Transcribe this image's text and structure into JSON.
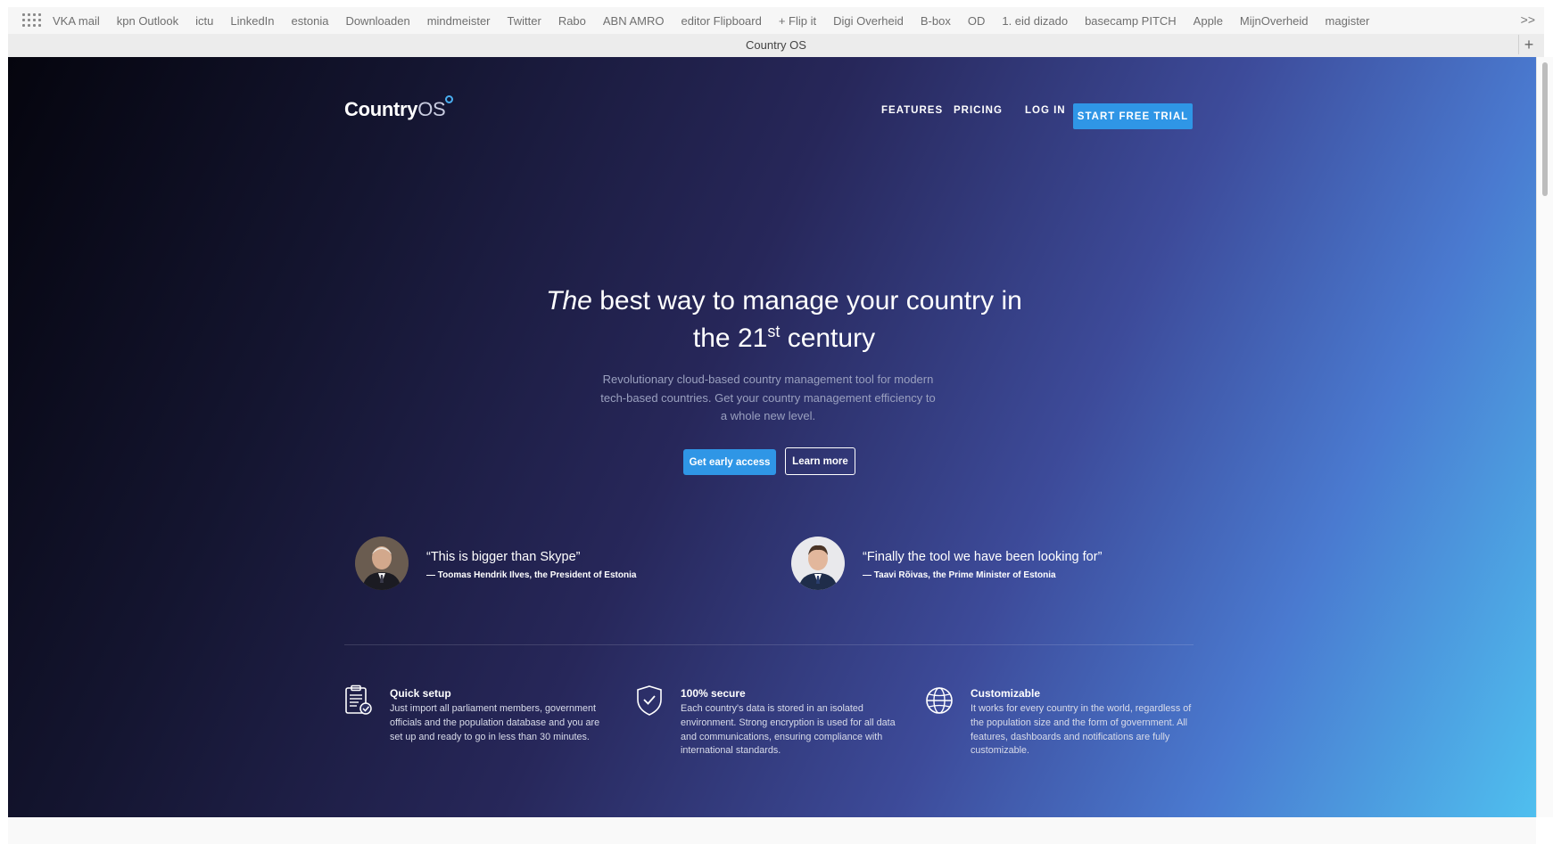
{
  "bookmarks": [
    "VKA mail",
    "kpn Outlook",
    "ictu",
    "LinkedIn",
    "estonia",
    "Downloaden",
    "mindmeister",
    "Twitter",
    "Rabo",
    "ABN AMRO",
    "editor Flipboard",
    "+ Flip it",
    "Digi Overheid",
    "B-box",
    "OD",
    "1. eid dizado",
    "basecamp PITCH",
    "Apple",
    "MijnOverheid",
    "magister"
  ],
  "bookmarks_more": ">>",
  "tab": {
    "title": "Country OS",
    "add": "+"
  },
  "site": {
    "logo": {
      "primary": "Country",
      "secondary": "OS"
    },
    "nav": {
      "features": "FEATURES",
      "pricing": "PRICING",
      "login": "LOG IN",
      "trial": "START FREE TRIAL"
    },
    "hero": {
      "title_emph": "The",
      "title_rest": "best way to manage your country in",
      "title_line2": "the 21",
      "title_sup": "st",
      "title_end": "century",
      "subtitle": "Revolutionary cloud-based country management tool for modern tech-based countries. Get your country management efficiency to a whole new level.",
      "cta_primary": "Get early access",
      "cta_secondary": "Learn more"
    },
    "testimonials": [
      {
        "quote": "“This is bigger than Skype”",
        "author": "— Toomas Hendrik Ilves, the President of Estonia"
      },
      {
        "quote": "“Finally the tool we have been looking for”",
        "author": "— Taavi Rõivas, the Prime Minister of Estonia"
      }
    ],
    "features": [
      {
        "icon": "clipboard-check-icon",
        "title": "Quick setup",
        "text": "Just import all parliament members, government officials and the population database and you are set up and ready to go in less than 30 minutes."
      },
      {
        "icon": "shield-check-icon",
        "title": "100% secure",
        "text": "Each country's data is stored in an isolated environment. Strong encryption is used for all data and communications, ensuring compliance with international standards."
      },
      {
        "icon": "globe-icon",
        "title": "Customizable",
        "text": "It works for every country in the world, regardless of the population size and the form of government. All features, dashboards and notifications are fully customizable."
      }
    ]
  },
  "colors": {
    "accent": "#2f96e6",
    "bg_dark": "#05050e",
    "bg_light": "#4fbfef"
  }
}
